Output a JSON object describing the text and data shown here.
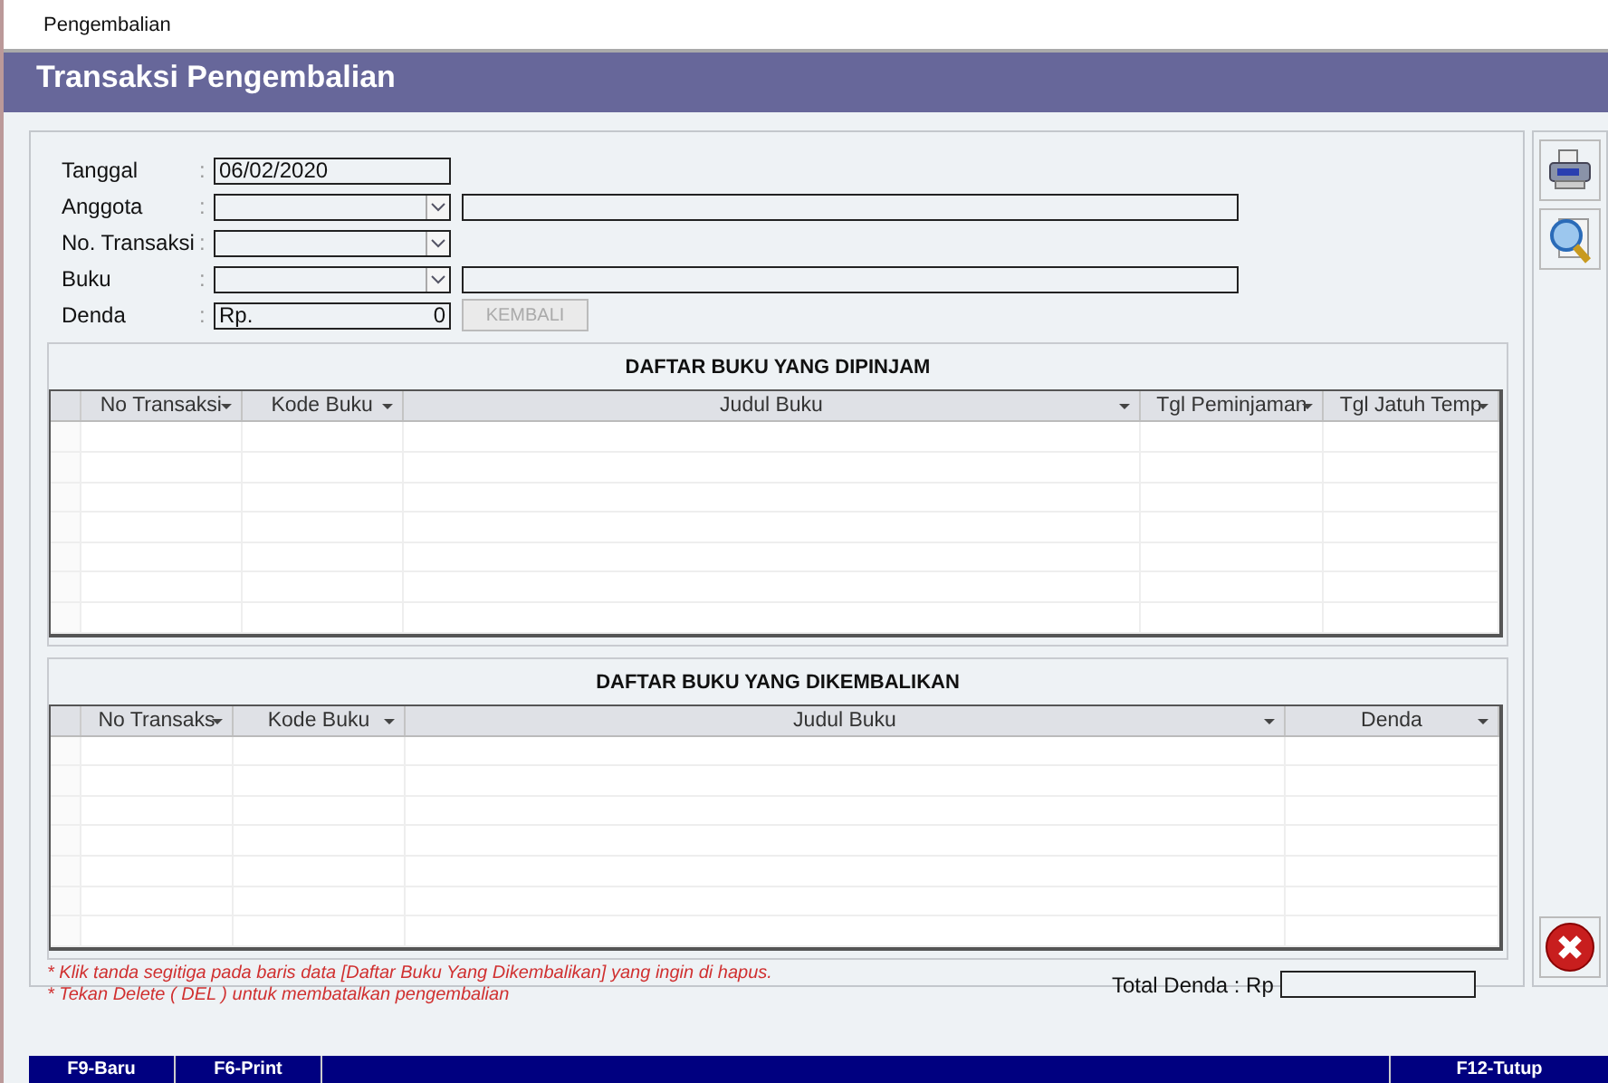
{
  "window": {
    "tab": "Pengembalian",
    "title": "Transaksi Pengembalian"
  },
  "form": [
    {
      "label": "Tanggal",
      "colon": ":",
      "kind": "date",
      "value": "06/02/2020"
    },
    {
      "label": "Anggota",
      "colon": ":",
      "kind": "combo_text"
    },
    {
      "label": "No. Transaksi",
      "colon": ":",
      "kind": "combo"
    },
    {
      "label": "Buku",
      "colon": ":",
      "kind": "combo_text"
    },
    {
      "label": "Denda",
      "colon": ":",
      "kind": "money",
      "prefix": "Rp.",
      "value": "0",
      "button": {
        "label": "KEMBALI",
        "disabled": true
      }
    }
  ],
  "borrowed": {
    "title": "DAFTAR BUKU YANG DIPINJAM",
    "columns": [
      "No Transaksi",
      "Kode Buku",
      "Judul Buku",
      "Tgl Peminjaman",
      "Tgl Jatuh Temp"
    ]
  },
  "returned": {
    "title": "DAFTAR BUKU YANG DIKEMBALIKAN",
    "columns": [
      "No Transaks",
      "Kode Buku",
      "Judul Buku",
      "Denda"
    ]
  },
  "notes": [
    "* Klik tanda segitiga pada baris data [Daftar Buku Yang Dikembalikan] yang ingin di hapus.",
    "* Tekan Delete ( DEL ) untuk membatalkan pengembalian"
  ],
  "total": {
    "label": "Total Denda  : Rp"
  },
  "status_bar": {
    "left": [
      "F9-Baru",
      "F6-Print"
    ],
    "right": "F12-Tutup"
  }
}
